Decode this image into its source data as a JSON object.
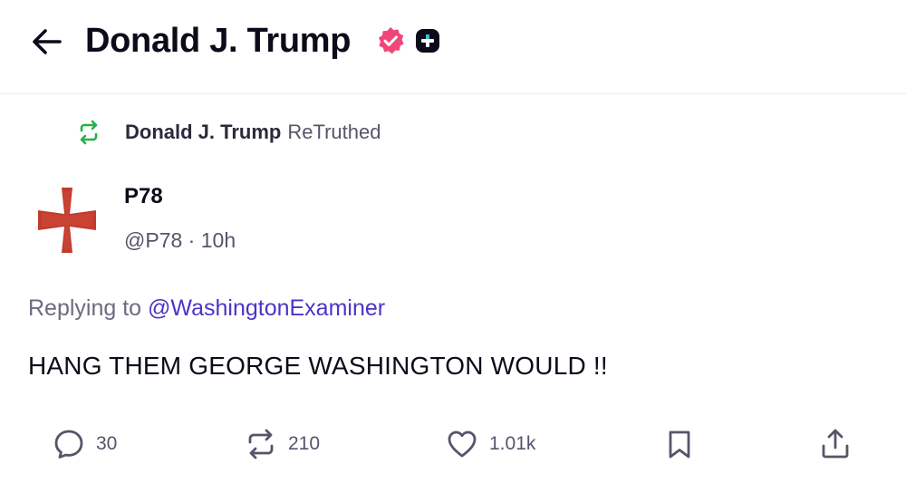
{
  "header": {
    "title": "Donald J. Trump",
    "back_icon": "arrow-left-icon",
    "verified_icon": "verified-badge-icon",
    "extra_icon": "plus-badge-icon",
    "verified_color": "#f0477b"
  },
  "retruth": {
    "icon": "retruth-icon",
    "name": "Donald J. Trump",
    "label": "ReTruthed",
    "icon_color": "#24b24a"
  },
  "post": {
    "author_name": "P78",
    "author_handle": "@P78",
    "separator": "·",
    "time": "10h",
    "avatar_icon": "cross-pattee-avatar",
    "avatar_color": "#c23b2e",
    "replying_prefix": "Replying to",
    "replying_to": "@WashingtonExaminer",
    "mention_color": "#4a35c8",
    "text": "HANG THEM GEORGE WASHINGTON WOULD !!"
  },
  "actions": {
    "reply": {
      "icon": "reply-icon",
      "count": "30"
    },
    "retruth": {
      "icon": "retruth-icon",
      "count": "210"
    },
    "like": {
      "icon": "heart-icon",
      "count": "1.01k"
    },
    "bookmark": {
      "icon": "bookmark-icon"
    },
    "share": {
      "icon": "share-icon"
    }
  }
}
